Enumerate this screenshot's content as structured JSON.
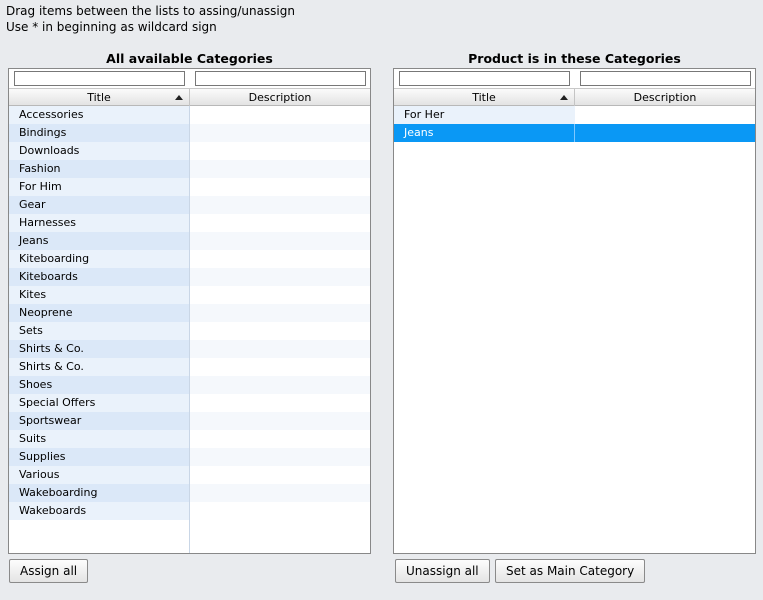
{
  "info": {
    "line1": "Drag items between the lists to assing/unassign",
    "line2": "Use * in beginning as wildcard sign"
  },
  "available": {
    "title": "All available Categories",
    "filter_title_value": "",
    "filter_desc_value": "",
    "columns": {
      "title": "Title",
      "description": "Description"
    },
    "sort": "ascending",
    "items": [
      {
        "title": "Accessories",
        "description": ""
      },
      {
        "title": "Bindings",
        "description": ""
      },
      {
        "title": "Downloads",
        "description": ""
      },
      {
        "title": "Fashion",
        "description": ""
      },
      {
        "title": "For Him",
        "description": ""
      },
      {
        "title": "Gear",
        "description": ""
      },
      {
        "title": "Harnesses",
        "description": ""
      },
      {
        "title": "Jeans",
        "description": ""
      },
      {
        "title": "Kiteboarding",
        "description": ""
      },
      {
        "title": "Kiteboards",
        "description": ""
      },
      {
        "title": "Kites",
        "description": ""
      },
      {
        "title": "Neoprene",
        "description": ""
      },
      {
        "title": "Sets",
        "description": ""
      },
      {
        "title": "Shirts & Co.",
        "description": ""
      },
      {
        "title": "Shirts & Co.",
        "description": ""
      },
      {
        "title": "Shoes",
        "description": ""
      },
      {
        "title": "Special Offers",
        "description": ""
      },
      {
        "title": "Sportswear",
        "description": ""
      },
      {
        "title": "Suits",
        "description": ""
      },
      {
        "title": "Supplies",
        "description": ""
      },
      {
        "title": "Various",
        "description": ""
      },
      {
        "title": "Wakeboarding",
        "description": ""
      },
      {
        "title": "Wakeboards",
        "description": ""
      }
    ]
  },
  "assigned": {
    "title": "Product is in these Categories",
    "filter_title_value": "",
    "filter_desc_value": "",
    "columns": {
      "title": "Title",
      "description": "Description"
    },
    "sort": "ascending",
    "items": [
      {
        "title": "For Her",
        "description": "",
        "selected": false
      },
      {
        "title": "Jeans",
        "description": "",
        "selected": true
      }
    ]
  },
  "buttons": {
    "assign_all": "Assign all",
    "unassign_all": "Unassign all",
    "set_main": "Set as Main Category"
  },
  "colors": {
    "selection": "#0a98f5",
    "background": "#e9ebee"
  }
}
